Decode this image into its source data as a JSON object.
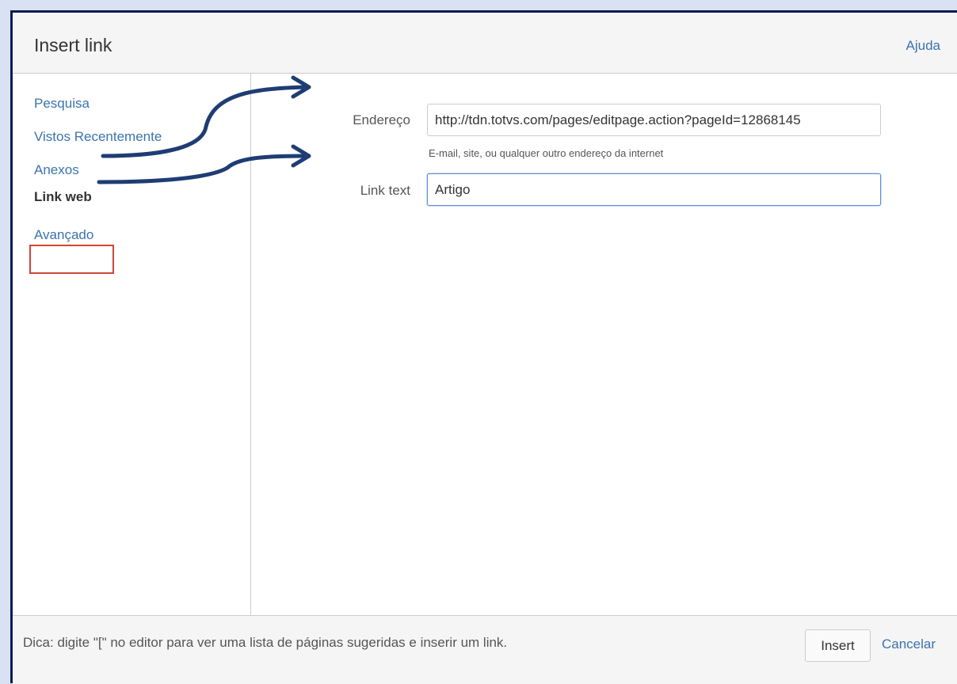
{
  "dialog": {
    "title": "Insert link",
    "help_label": "Ajuda"
  },
  "sidebar": {
    "items": [
      {
        "label": "Pesquisa"
      },
      {
        "label": "Vistos Recentemente"
      },
      {
        "label": "Anexos"
      },
      {
        "label": "Link web",
        "selected": true
      },
      {
        "label": "Avançado"
      }
    ]
  },
  "form": {
    "address_label": "Endereço",
    "address_value": "http://tdn.totvs.com/pages/editpage.action?pageId=12868145",
    "address_hint": "E-mail, site, ou qualquer outro endereço da internet",
    "link_text_label": "Link text",
    "link_text_value": "Artigo"
  },
  "footer": {
    "tip": "Dica: digite \"[\" no editor para ver uma lista de páginas sugeridas e inserir um link.",
    "insert_label": "Insert",
    "cancel_label": "Cancelar"
  },
  "colors": {
    "accent": "#3b73af",
    "annotation_arrow": "#1f3d73",
    "highlight_box": "#d04437"
  }
}
